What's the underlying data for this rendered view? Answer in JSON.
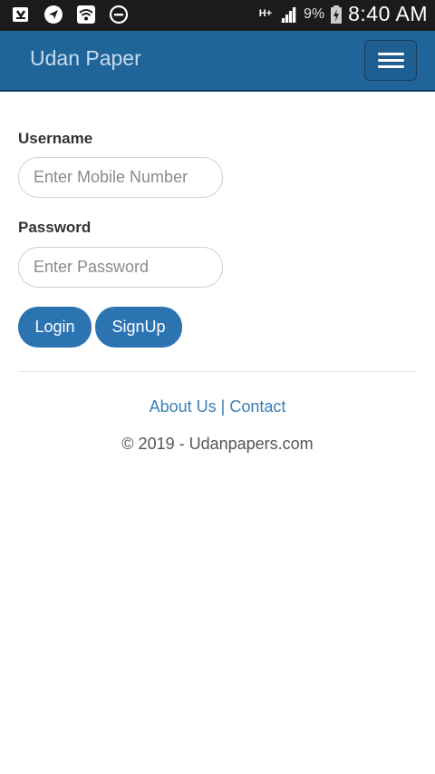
{
  "status_bar": {
    "left_icons": [
      "download-notification-icon",
      "navigation-icon",
      "wifi-icon",
      "do-not-disturb-icon"
    ],
    "network": "H+",
    "battery_percent": "9%",
    "time": "8:40 AM"
  },
  "navbar": {
    "brand": "Udan Paper",
    "menu_icon": "hamburger-menu-icon"
  },
  "form": {
    "username_label": "Username",
    "username_placeholder": "Enter Mobile Number",
    "password_label": "Password",
    "password_placeholder": "Enter Password",
    "login_label": "Login",
    "signup_label": "SignUp"
  },
  "footer": {
    "about_label": "About Us",
    "separator": "|",
    "contact_label": "Contact",
    "copyright": "© 2019 - Udanpapers.com"
  },
  "colors": {
    "navbar": "#20659a",
    "primary_button": "#2c73b2",
    "link": "#3a7fb5",
    "status_bar": "#1b1b1b"
  }
}
